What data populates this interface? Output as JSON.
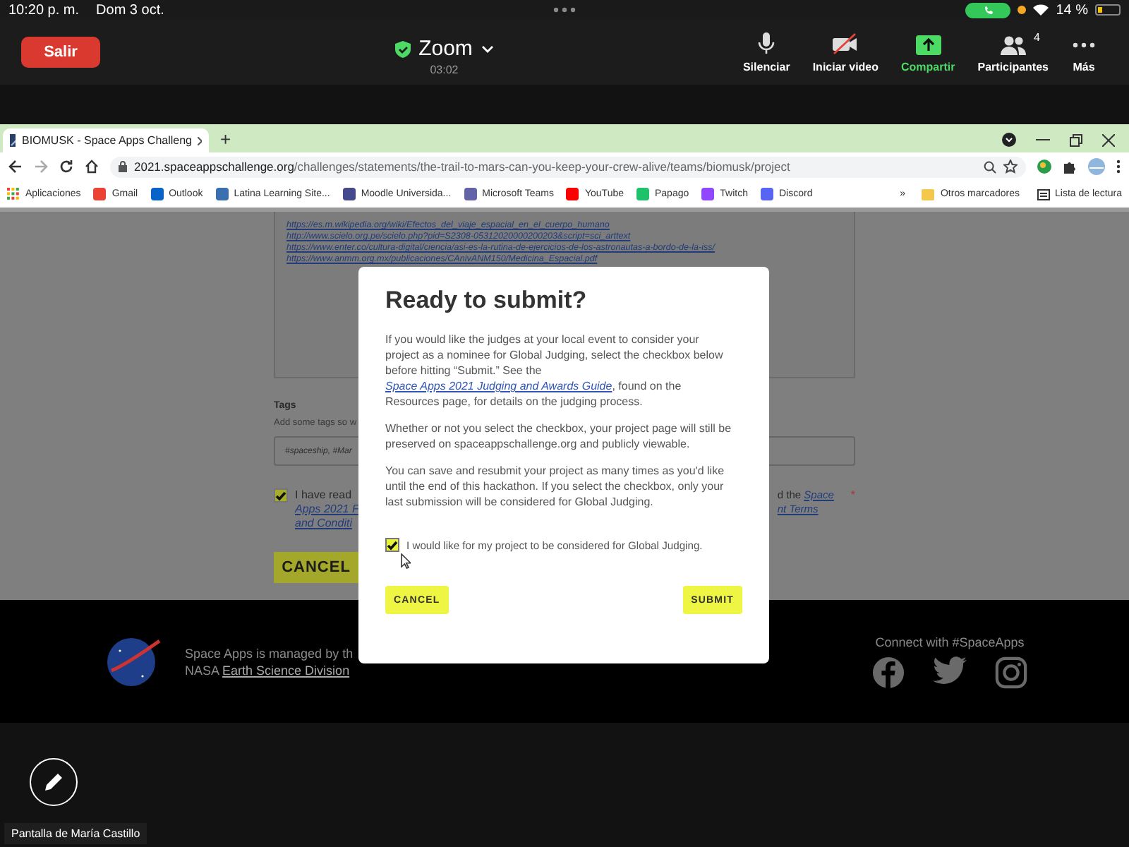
{
  "status_bar": {
    "time": "10:20 p. m.",
    "date": "Dom 3 oct.",
    "battery": "14 %"
  },
  "meeting": {
    "leave": "Salir",
    "title": "Zoom",
    "timer": "03:02",
    "actions": [
      {
        "kind": "mic",
        "label": "Silenciar"
      },
      {
        "kind": "video",
        "label": "Iniciar video"
      },
      {
        "kind": "share",
        "label": "Compartir"
      },
      {
        "kind": "participants",
        "label": "Participantes",
        "badge": "4"
      },
      {
        "kind": "more",
        "label": "Más"
      }
    ]
  },
  "browser": {
    "tabs": [
      {
        "title": "BIOMUSK - Space Apps Challeng",
        "selected": true
      }
    ],
    "new_tab": "+",
    "url_host": "2021.spaceappschallenge.org",
    "url_path": "/challenges/statements/the-trail-to-mars-can-you-keep-your-crew-alive/teams/biomusk/project",
    "bookmarks": [
      {
        "kind": "apps",
        "label": "Aplicaciones"
      },
      {
        "kind": "gmail",
        "label": "Gmail"
      },
      {
        "kind": "outlook",
        "label": "Outlook"
      },
      {
        "kind": "latina",
        "label": "Latina Learning Site..."
      },
      {
        "kind": "moodle",
        "label": "Moodle Universida..."
      },
      {
        "kind": "teams",
        "label": "Microsoft Teams"
      },
      {
        "kind": "youtube",
        "label": "YouTube"
      },
      {
        "kind": "papago",
        "label": "Papago"
      },
      {
        "kind": "twitch",
        "label": "Twitch"
      },
      {
        "kind": "discord",
        "label": "Discord"
      }
    ],
    "overflow": "»",
    "other_bookmarks": "Otros marcadores",
    "reading_list": "Lista de lectura"
  },
  "page": {
    "links": [
      "https://es.m.wikipedia.org/wiki/Efectos_del_viaje_espacial_en_el_cuerpo_humano",
      "http://www.scielo.org.pe/scielo.php?pid=S2308-05312020000200203&script=sci_arttext",
      "https://www.enter.co/cultura-digital/ciencia/asi-es-la-rutina-de-ejercicios-de-los-astronautas-a-bordo-de-la-iss/",
      "https://www.anmm.org.mx/publicaciones/CAnivANM150/Medicina_Espacial.pdf"
    ],
    "tags_label": "Tags",
    "tags_hint": "Add some tags so w",
    "tags_value": "#spaceship, #Mar",
    "agreement": {
      "checked": true,
      "left_text": "I have read",
      "left_links": [
        "Apps 2021 F",
        "and Conditi"
      ],
      "right_text": "d the",
      "right_links": [
        "Space",
        "nt Terms"
      ],
      "required": "*"
    },
    "cancel": "CANCEL"
  },
  "footer": {
    "managed_by": "Space Apps is managed by th",
    "division_prefix": "NASA",
    "division_link": "Earth Science Division",
    "connect": "Connect with #SpaceApps"
  },
  "dialog": {
    "title": "Ready to submit?",
    "intro_before": "If you would like the judges at your local event to consider your project as a nominee for Global Judging, select the checkbox below before hitting “Submit.” See the",
    "intro_link": "Space Apps 2021 Judging and Awards Guide",
    "intro_after": ", found on the Resources page, for details on the judging process.",
    "paragraphs": [
      "Whether or not you select the checkbox, your project page will still be preserved on spaceappschallenge.org and publicly viewable.",
      "You can save and resubmit your project as many times as you'd like until the end of this hackathon. If you select the checkbox, only your last submission will be considered for Global Judging."
    ],
    "checkbox": {
      "label": "I would like for my project to be considered for Global Judging.",
      "checked": true
    },
    "cancel": "CANCEL",
    "submit": "SUBMIT"
  },
  "screen_share": {
    "label": "Pantalla de María Castillo"
  }
}
